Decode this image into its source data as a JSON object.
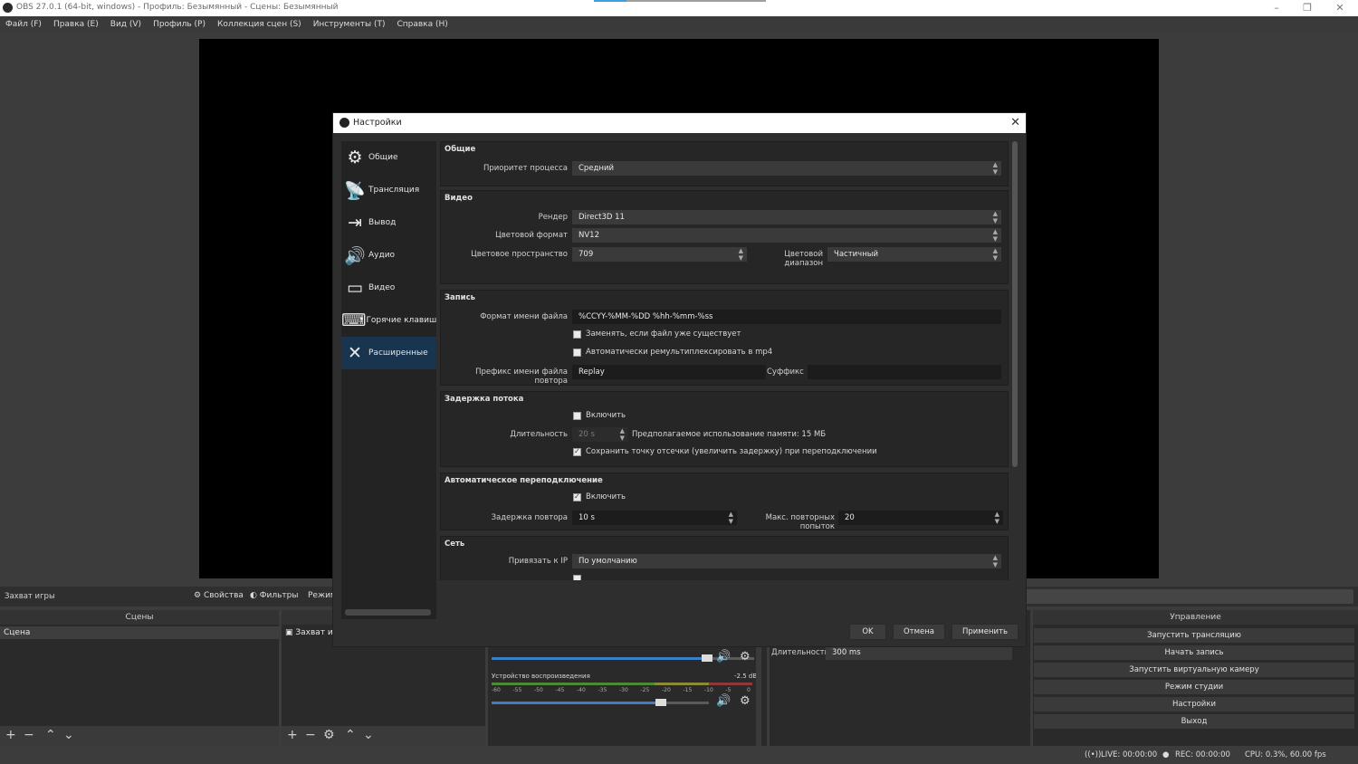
{
  "window": {
    "title": "OBS 27.0.1 (64-bit, windows) - Профиль: Безымянный - Сцены: Безымянный",
    "minimize": "–",
    "restore": "❐",
    "close": "✕"
  },
  "menu": [
    "Файл (F)",
    "Правка (E)",
    "Вид (V)",
    "Профиль (P)",
    "Коллекция сцен (S)",
    "Инструменты (T)",
    "Справка (H)"
  ],
  "source_toolbar": {
    "current_source": "Захват игры",
    "properties": "Свойства",
    "filters": "Фильтры",
    "mode": "Режим"
  },
  "scenes": {
    "header": "Сцены",
    "items": [
      "Сцена"
    ]
  },
  "sources": {
    "items": [
      "Захват и"
    ]
  },
  "mixer": {
    "device": "Устройство воспроизведения",
    "level": "-2.5 dB",
    "ticks": [
      "-60",
      "-55",
      "-50",
      "-45",
      "-40",
      "-35",
      "-30",
      "-25",
      "-20",
      "-15",
      "-10",
      "-5",
      "0"
    ],
    "volume_fraction": 0.82,
    "device_volume_fraction": 0.78
  },
  "transitions": {
    "duration_label": "Длительность",
    "duration_value": "300 ms"
  },
  "controls": {
    "header": "Управление",
    "buttons": [
      "Запустить трансляцию",
      "Начать запись",
      "Запустить виртуальную камеру",
      "Режим студии",
      "Настройки",
      "Выход"
    ]
  },
  "status": {
    "live": "LIVE: 00:00:00",
    "rec": "REC: 00:00:00",
    "cpu": "CPU: 0.3%, 60.00 fps"
  },
  "settings_dialog": {
    "title": "Настройки",
    "close": "✕",
    "categories": [
      {
        "label": "Общие",
        "icon": "gear-icon"
      },
      {
        "label": "Трансляция",
        "icon": "broadcast-icon"
      },
      {
        "label": "Вывод",
        "icon": "output-icon"
      },
      {
        "label": "Аудио",
        "icon": "speaker-icon"
      },
      {
        "label": "Видео",
        "icon": "monitor-icon"
      },
      {
        "label": "Горячие клавиши",
        "icon": "keyboard-icon"
      },
      {
        "label": "Расширенные",
        "icon": "tools-icon",
        "selected": true
      }
    ],
    "general": {
      "header": "Общие",
      "priority_label": "Приоритет процесса",
      "priority_value": "Средний"
    },
    "video": {
      "header": "Видео",
      "renderer_label": "Рендер",
      "renderer_value": "Direct3D 11",
      "color_format_label": "Цветовой формат",
      "color_format_value": "NV12",
      "color_space_label": "Цветовое пространство",
      "color_space_value": "709",
      "color_range_label": "Цветовой диапазон",
      "color_range_value": "Частичный"
    },
    "recording": {
      "header": "Запись",
      "filename_label": "Формат имени файла",
      "filename_value": "%CCYY-%MM-%DD %hh-%mm-%ss",
      "overwrite_label": "Заменять, если файл уже существует",
      "overwrite_checked": false,
      "remux_label": "Автоматически ремультиплексировать в mp4",
      "remux_checked": false,
      "replay_prefix_label": "Префикс имени файла повтора",
      "replay_prefix_value": "Replay",
      "suffix_label": "Суффикс",
      "suffix_value": ""
    },
    "stream_delay": {
      "header": "Задержка потока",
      "enable_label": "Включить",
      "enable_checked": false,
      "duration_label": "Длительность",
      "duration_value": "20 s",
      "memory_text": "Предполагаемое использование памяти: 15 МБ",
      "preserve_label": "Сохранить точку отсечки (увеличить задержку) при переподключении",
      "preserve_checked": true
    },
    "reconnect": {
      "header": "Автоматическое переподключение",
      "enable_label": "Включить",
      "enable_checked": true,
      "delay_label": "Задержка повтора",
      "delay_value": "10 s",
      "retries_label": "Макс. повторных попыток",
      "retries_value": "20"
    },
    "network": {
      "header": "Сеть",
      "bind_label": "Привязать к IP",
      "bind_value": "По умолчанию"
    },
    "buttons": {
      "ok": "OK",
      "cancel": "Отмена",
      "apply": "Применить"
    }
  }
}
